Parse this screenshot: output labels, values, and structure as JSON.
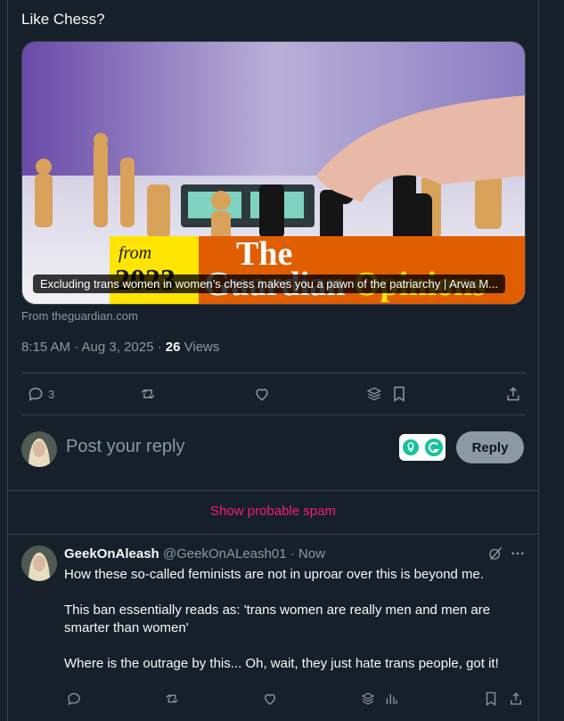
{
  "post": {
    "text": "Like Chess?",
    "card": {
      "caption": "Excluding trans women in women’s chess makes you a pawn of the patriarchy | Arwa M...",
      "source": "From theguardian.com",
      "banner_from": "from",
      "banner_year": "2023",
      "banner_brand": "The",
      "banner_brand2": "Guardian",
      "banner_section": "Opinions"
    },
    "time": "8:15 AM · Aug 3, 2025 · ",
    "views_count": "26",
    "views_label": " Views",
    "actions": {
      "reply_count": "3"
    }
  },
  "composer": {
    "placeholder": "Post your reply",
    "reply_button": "Reply"
  },
  "spam_link": "Show probable spam",
  "reply": {
    "name": "GeekOnAleash",
    "handle": "@GeekOnALeash01",
    "dot": " · ",
    "time": "Now",
    "paragraphs": [
      "How these so-called feminists are not in uproar over this is beyond me.",
      "This ban essentially reads as: 'trans women are really men and men are smarter than women'",
      "Where is the outrage by this... Oh, wait, they just hate trans people, got it!"
    ]
  },
  "colors": {
    "background": "#15202b",
    "border": "#38444d",
    "muted": "#8b98a5",
    "spam_pink": "#f91880",
    "guardian_orange": "#e05e00",
    "guardian_yellow": "#ffe500"
  }
}
